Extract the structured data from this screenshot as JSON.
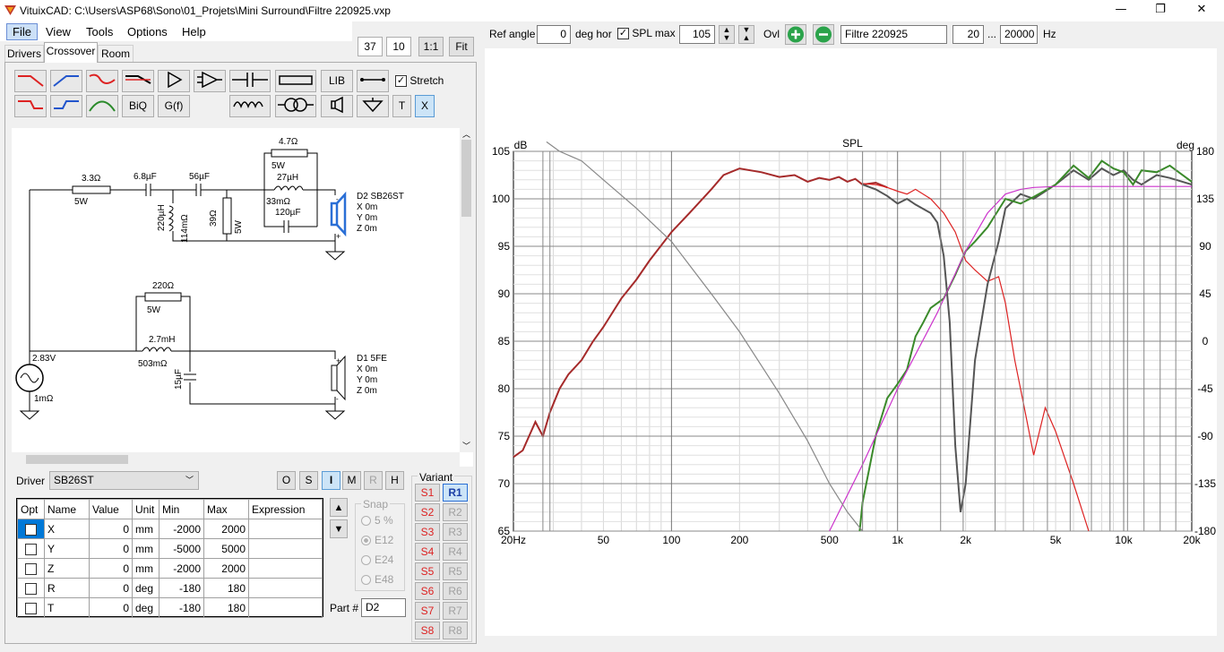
{
  "window": {
    "title": "VituixCAD: C:\\Users\\ASP68\\Sono\\01_Projets\\Mini Surround\\Filtre 220925.vxp",
    "minimize": "—",
    "maximize": "❐",
    "close": "✕"
  },
  "menu": {
    "file": "File",
    "view": "View",
    "tools": "Tools",
    "options": "Options",
    "help": "Help"
  },
  "toolbar": {
    "zoom_w": "37",
    "zoom_h": "10",
    "one_to_one": "1:1",
    "fit": "Fit"
  },
  "tabs": {
    "drivers": "Drivers",
    "crossover": "Crossover",
    "room": "Room"
  },
  "palette": {
    "lib": "LIB",
    "biq": "BiQ",
    "gf": "G(f)",
    "t": "T",
    "x": "X",
    "stretch": "Stretch"
  },
  "schematic": {
    "r1": "3.3Ω",
    "r1w": "5W",
    "c1": "6.8µF",
    "c2": "56µF",
    "l1": "220µH",
    "l1r": "114mΩ",
    "r2": "39Ω",
    "r2w": "5W",
    "r3": "4.7Ω",
    "r3w": "5W",
    "l2": "27µH",
    "l2r": "33mΩ",
    "c3": "120µF",
    "d2": "D2 SB26ST",
    "d2x": "X 0m",
    "d2y": "Y 0m",
    "d2z": "Z 0m",
    "r4": "220Ω",
    "r4w": "5W",
    "l3": "2.7mH",
    "l3r": "503mΩ",
    "c4": "15µF",
    "src_v": "2.83V",
    "src_r": "1mΩ",
    "d1": "D1 5FE",
    "d1x": "X 0m",
    "d1y": "Y 0m",
    "d1z": "Z 0m"
  },
  "driver_bar": {
    "label": "Driver",
    "selected": "SB26ST",
    "modes": [
      "O",
      "S",
      "I",
      "M",
      "R",
      "H"
    ]
  },
  "grid": {
    "headers": [
      "Opt",
      "Name",
      "Value",
      "Unit",
      "Min",
      "Max",
      "Expression"
    ],
    "rows": [
      [
        "X",
        "0",
        "mm",
        "-2000",
        "2000"
      ],
      [
        "Y",
        "0",
        "mm",
        "-5000",
        "5000"
      ],
      [
        "Z",
        "0",
        "mm",
        "-2000",
        "2000"
      ],
      [
        "R",
        "0",
        "deg",
        "-180",
        "180"
      ],
      [
        "T",
        "0",
        "deg",
        "-180",
        "180"
      ]
    ]
  },
  "snap": {
    "title": "Snap",
    "options": [
      "5 %",
      "E12",
      "E24",
      "E48"
    ],
    "selected": "E12"
  },
  "part": {
    "label": "Part #",
    "value": "D2"
  },
  "variant": {
    "title": "Variant",
    "s": [
      "S1",
      "S2",
      "S3",
      "S4",
      "S5",
      "S6",
      "S7",
      "S8"
    ],
    "r": [
      "R1",
      "R2",
      "R3",
      "R4",
      "R5",
      "R6",
      "R7",
      "R8"
    ]
  },
  "chart_controls": {
    "ref_angle_label": "Ref angle",
    "ref_angle": "0",
    "deg_hor": "deg hor",
    "spl_max_label": "SPL max",
    "spl_max": "105",
    "ovl": "Ovl",
    "name": "Filtre 220925",
    "f_min": "20",
    "dots": "...",
    "f_max": "20000",
    "hz": "Hz"
  },
  "chart_data": {
    "type": "line",
    "title": "SPL",
    "ylabel": "dB",
    "y2label": "deg",
    "xscale": "log",
    "xlim": [
      20,
      20000
    ],
    "ylim": [
      65,
      105
    ],
    "y2lim": [
      -180,
      180
    ],
    "x_ticks": [
      "20Hz",
      "50",
      "100",
      "200",
      "500",
      "1k",
      "2k",
      "5k",
      "10k",
      "20k"
    ],
    "x_tick_values": [
      20,
      50,
      100,
      200,
      500,
      1000,
      2000,
      5000,
      10000,
      20000
    ],
    "y_ticks": [
      65,
      70,
      75,
      80,
      85,
      90,
      95,
      100,
      105
    ],
    "y2_ticks": [
      -180,
      -135,
      -90,
      -45,
      0,
      45,
      90,
      135,
      180
    ],
    "colors": {
      "total": "#a52a2a",
      "woofer_red": "#dd2222",
      "tweeter_green": "#3a8a2a",
      "total_dark": "#555555",
      "target": "#cc33cc",
      "phase": "#888888"
    },
    "series": [
      {
        "color": "#a52a2a",
        "x": [
          20,
          22,
          25,
          27,
          29,
          32,
          35,
          40,
          45,
          50,
          60,
          70,
          80,
          100,
          120,
          150,
          170,
          200,
          250,
          300,
          350,
          400,
          450,
          500,
          550,
          600,
          650,
          700,
          800,
          900
        ],
        "values": [
          72.8,
          73.5,
          76.5,
          75,
          77.5,
          80,
          81.5,
          83,
          85,
          86.5,
          89.5,
          91.5,
          93.5,
          96.5,
          98.5,
          101,
          102.5,
          103.2,
          102.8,
          102.3,
          102.5,
          101.8,
          102.2,
          102,
          102.3,
          101.8,
          102.1,
          101.5,
          101.7,
          101.2
        ]
      },
      {
        "color": "#dd2222",
        "x": [
          700,
          800,
          900,
          1000,
          1100,
          1200,
          1400,
          1600,
          1800,
          2000,
          2200,
          2500,
          2800,
          3000,
          3300,
          3600,
          4000,
          4500,
          5000,
          6000,
          7000
        ],
        "values": [
          101.6,
          101.5,
          101.2,
          100.8,
          100.5,
          101,
          100,
          98.5,
          96.5,
          93.5,
          92.5,
          91.3,
          91.8,
          89,
          83,
          78.5,
          73,
          78,
          75.5,
          70,
          65
        ]
      },
      {
        "color": "#555555",
        "x": [
          700,
          800,
          900,
          1000,
          1100,
          1200,
          1400,
          1500,
          1600,
          1700,
          1800,
          1900,
          2000,
          2200,
          2500,
          2800,
          3000,
          3500,
          4000,
          5000,
          6000,
          7000,
          8000,
          9000,
          10000,
          11000,
          12000,
          14000,
          16000,
          20000
        ],
        "values": [
          101.5,
          101,
          100.3,
          99.5,
          100,
          99.4,
          98.5,
          97.5,
          94,
          87,
          74,
          67,
          70,
          83,
          91,
          95.5,
          99,
          100.5,
          100,
          101.5,
          103,
          102,
          103.2,
          102.5,
          103,
          102,
          101.5,
          102.5,
          102.2,
          101.5
        ]
      },
      {
        "color": "#3a8a2a",
        "x": [
          680,
          700,
          800,
          900,
          1000,
          1100,
          1200,
          1300,
          1400,
          1600,
          1800,
          2000,
          2200,
          2500,
          3000,
          3500,
          4000,
          5000,
          6000,
          7000,
          8000,
          9000,
          10000,
          11000,
          12000,
          14000,
          16000,
          20000
        ],
        "values": [
          65,
          68,
          75,
          79,
          80.5,
          82,
          85.5,
          87,
          88.5,
          89.5,
          92,
          94.5,
          95.5,
          97,
          100,
          99.5,
          100.2,
          101.5,
          103.5,
          102.2,
          104,
          103.2,
          102.8,
          101.5,
          103,
          102.8,
          103.5,
          101.8
        ]
      },
      {
        "color": "#cc33cc",
        "x": [
          500,
          700,
          1000,
          1500,
          2000,
          2500,
          3000,
          3500,
          4000,
          5000,
          7000,
          10000,
          20000
        ],
        "values": [
          65,
          72,
          80,
          88,
          94.5,
          98.5,
          100.5,
          101,
          101.2,
          101.3,
          101.3,
          101.3,
          101.3
        ]
      },
      {
        "color": "#888888",
        "x": [
          28,
          32,
          40,
          50,
          70,
          100,
          150,
          200,
          300,
          400,
          500,
          600,
          700
        ],
        "values": [
          106,
          105,
          104,
          102,
          99,
          95.5,
          90,
          86,
          79.5,
          74.5,
          70,
          67,
          65
        ]
      }
    ]
  }
}
